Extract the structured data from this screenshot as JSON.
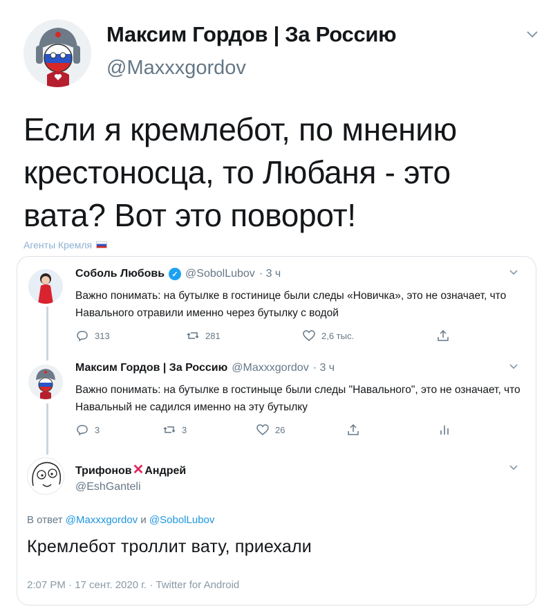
{
  "outer": {
    "name": "Максим Гордов | За Россию",
    "handle": "@Maxxxgordov",
    "text": "Если я кремлебот, по мнению крестоносца, то Любаня  - это вата? Вот это поворот!",
    "label": "Агенты Кремля",
    "icons": {
      "menu": "chevron-down-icon",
      "flag": "russian-flag-icon"
    }
  },
  "thread": [
    {
      "name": "Соболь Любовь",
      "verified": true,
      "handle": "@SobolLubov",
      "time": "· 3 ч",
      "text": "Важно понимать: на бутылке в гостинице были следы «Новичка», это не означает, что Навального отравили именно через бутылку с водой",
      "actions": {
        "reply": "313",
        "retweet": "281",
        "like": "2,6 тыс."
      }
    },
    {
      "name": "Максим Гордов | За Россию",
      "handle": "@Maxxxgordov",
      "time": "· 3 ч",
      "text": "Важно понимать: на бутылке в гостиныце были следы \"Навального\", это не означает, что Навальный не садился именно на эту бутылку",
      "actions": {
        "reply": "3",
        "retweet": "3",
        "like": "26"
      }
    }
  ],
  "main": {
    "name_part1": "Трифонов",
    "name_part2": "Андрей",
    "name_mark": "✕",
    "handle": "@EshGanteli",
    "reply_prefix": "В ответ",
    "reply_mention1": "@Maxxxgordov",
    "reply_and": "и",
    "reply_mention2": "@SobolLubov",
    "text": "Кремлебот троллит вату, приехали",
    "meta": "2:07 PM · 17 сент. 2020 г. · Twitter for Android"
  },
  "colors": {
    "link": "#1b95e0",
    "secondary": "#657786",
    "verified": "#1da1f2",
    "x_mark": "#e0245e",
    "label": "#8cb1d4"
  }
}
